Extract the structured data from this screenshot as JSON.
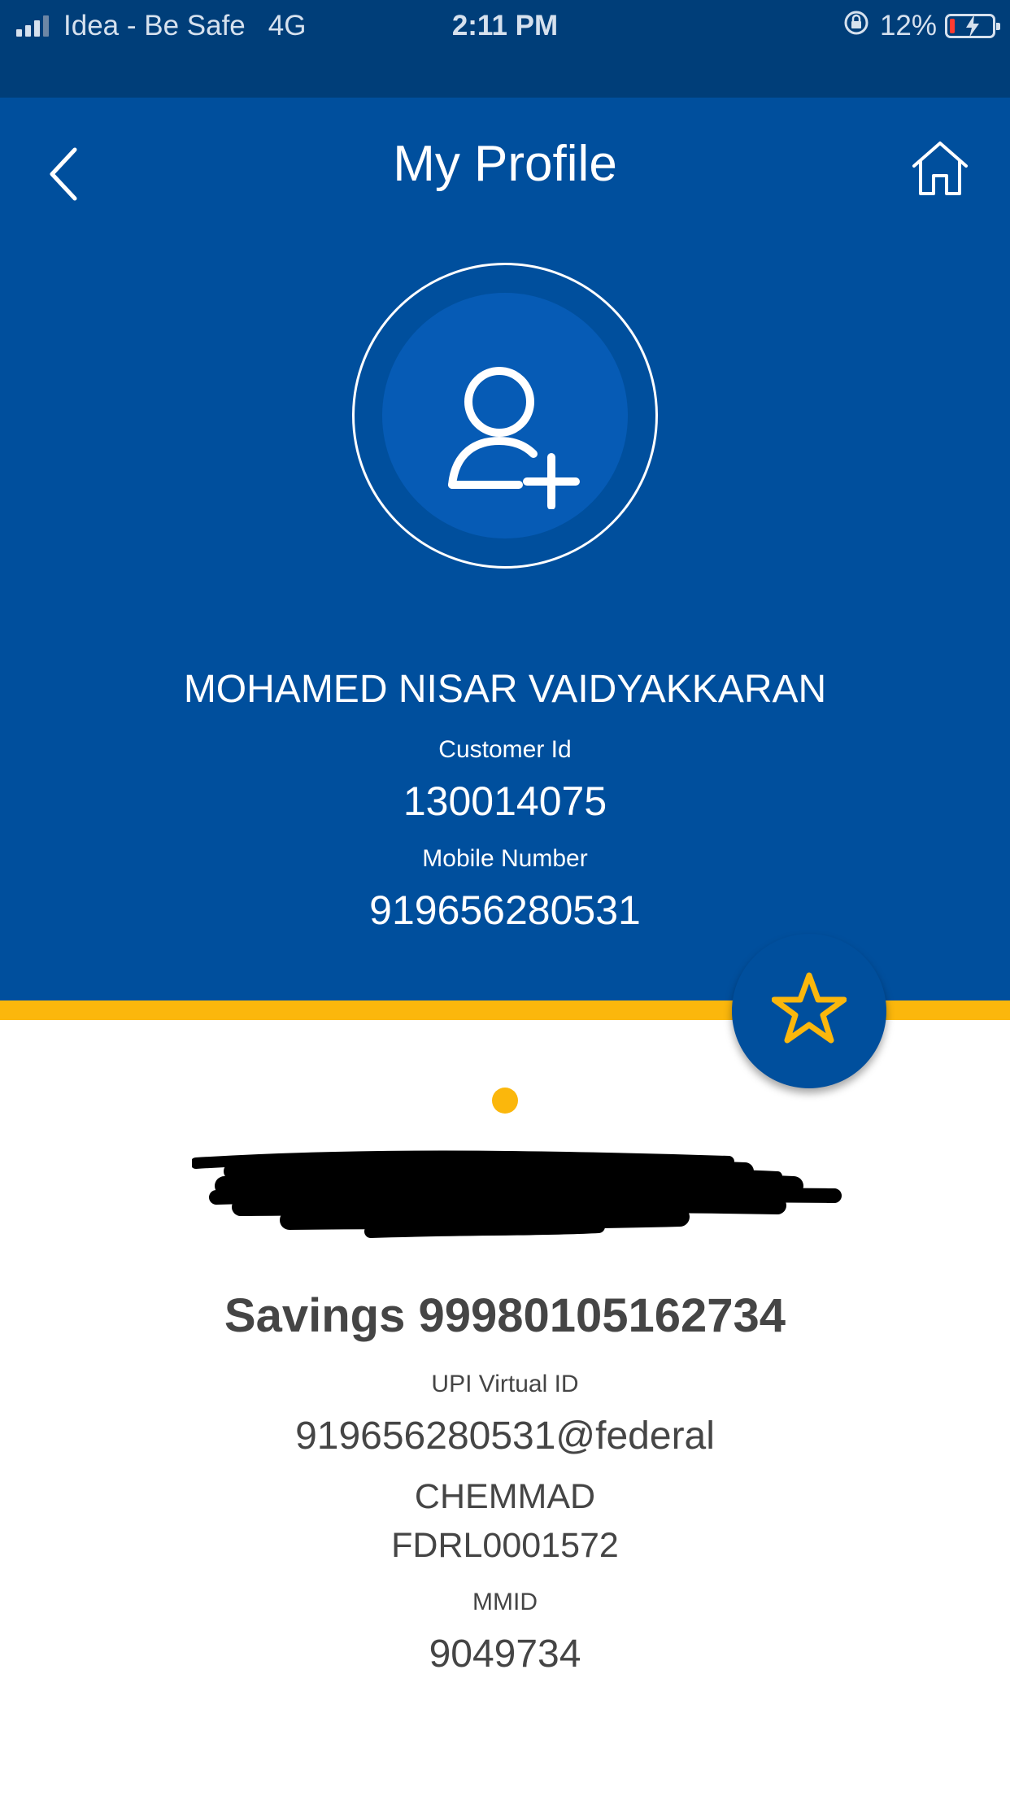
{
  "status_bar": {
    "carrier": "Idea - Be Safe",
    "network": "4G",
    "time": "2:11 PM",
    "battery_percent": "12%",
    "battery_level": 0.12
  },
  "header": {
    "title": "My Profile",
    "back_icon": "chevron-left-icon",
    "home_icon": "home-icon"
  },
  "profile": {
    "avatar_icon": "add-user-icon",
    "name": "MOHAMED NISAR VAIDYAKKARAN",
    "customer_id_label": "Customer Id",
    "customer_id": "130014075",
    "mobile_label": "Mobile Number",
    "mobile": "919656280531"
  },
  "favorite": {
    "icon": "star-icon"
  },
  "account": {
    "title": "Savings 99980105162734",
    "upi_label": "UPI Virtual ID",
    "upi_id": "919656280531@federal",
    "branch": "CHEMMAD",
    "ifsc": "FDRL0001572",
    "mmid_label": "MMID",
    "mmid": "9049734"
  },
  "colors": {
    "primary_blue": "#004f9d",
    "status_blue": "#003e79",
    "accent_gold": "#fbb70c",
    "text_dark": "#454545"
  }
}
